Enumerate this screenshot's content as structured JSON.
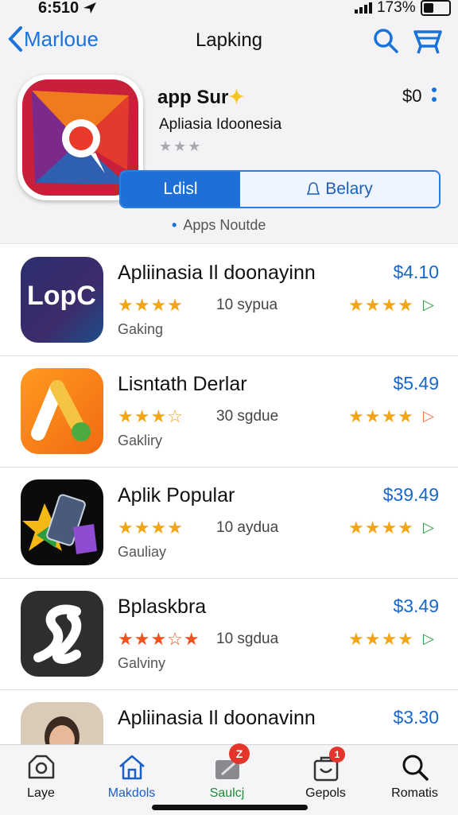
{
  "status_bar": {
    "time": "6:510",
    "battery": "173%"
  },
  "nav": {
    "back_label": "Marloue",
    "title": "Lapking"
  },
  "featured": {
    "name": "app Sur",
    "price": "$0",
    "subtitle": "Apliasia Idoonesia",
    "rating_stars": "★★★",
    "segment_left": "Ldisl",
    "segment_right": "Belary",
    "note": "Apps Noutde"
  },
  "apps": [
    {
      "name": "Apliinasia Il doonayinn",
      "price": "$4.10",
      "stars": "★★★★",
      "count": "10 sypua",
      "rstars": "★★★★",
      "category": "Gaking",
      "icon": "lopc-icon",
      "icon_text": "LopC"
    },
    {
      "name": "Lisntath Derlar",
      "price": "$5.49",
      "stars": "★★★☆",
      "count": "30 sgdue",
      "rstars": "★★★★",
      "category": "Gakliry",
      "icon": "a-logo-icon"
    },
    {
      "name": "Aplik Popular",
      "price": "$39.49",
      "stars": "★★★★",
      "count": "10 aydua",
      "rstars": "★★★★",
      "category": "Gauliay",
      "icon": "phone-star-icon"
    },
    {
      "name": "Bplaskbra",
      "price": "$3.49",
      "stars": "★★★☆★",
      "count": "10 sgdua",
      "rstars": "★★★★",
      "category": "Galviny",
      "icon": "s-logo-icon"
    },
    {
      "name": "Apliinasia Il doonavinn",
      "price": "$3.30",
      "stars": "★★★★",
      "count": "",
      "rstars": "",
      "category": "",
      "icon": "person-photo-icon"
    }
  ],
  "tabs": [
    {
      "label": "Laye",
      "icon": "camera-icon"
    },
    {
      "label": "Makdols",
      "icon": "home-icon"
    },
    {
      "label": "Saulcj",
      "icon": "pencil-icon",
      "badge": "Z"
    },
    {
      "label": "Gepols",
      "icon": "bag-icon",
      "badge": "1"
    },
    {
      "label": "Romatis",
      "icon": "search-icon"
    }
  ],
  "colors": {
    "accent": "#1f6fd9",
    "star": "#f4a516",
    "price": "#1a66c8",
    "badge": "#e5352b"
  }
}
